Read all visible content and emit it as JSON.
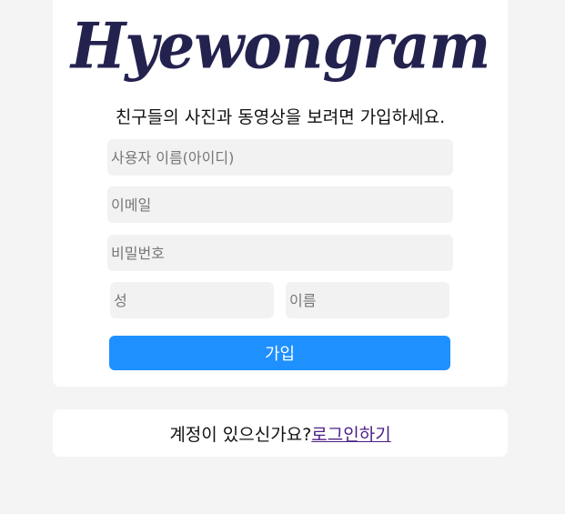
{
  "brand": {
    "logo_text": "Hyewongram"
  },
  "signup": {
    "tagline": "친구들의 사진과 동영상을 보려면 가입하세요.",
    "fields": {
      "username_placeholder": "사용자 이름(아이디)",
      "email_placeholder": "이메일",
      "password_placeholder": "비밀번호",
      "last_name_placeholder": "성",
      "first_name_placeholder": "이름"
    },
    "submit_label": "가입"
  },
  "login": {
    "prompt": "계정이 있으신가요?",
    "link_label": "로그인하기"
  },
  "colors": {
    "background": "#f4f4f4",
    "card": "#ffffff",
    "logo": "#23224f",
    "button": "#1e90ff",
    "input_bg": "#f2f2f2",
    "link": "#4b1e86"
  }
}
